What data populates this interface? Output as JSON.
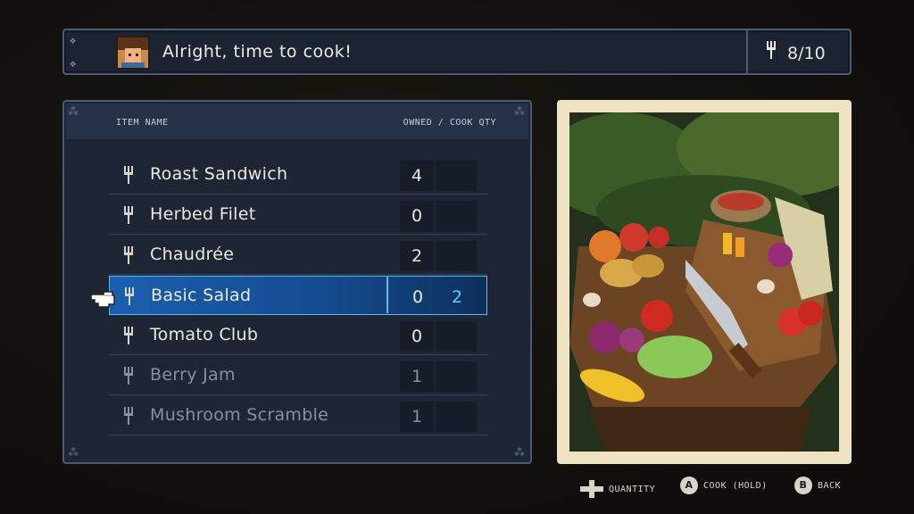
{
  "header": {
    "message": "Alright, time to cook!",
    "fork_count": "8/10"
  },
  "table": {
    "col_name": "ITEM NAME",
    "col_qty": "OWNED / COOK QTY",
    "rows": [
      {
        "name": "Roast Sandwich",
        "owned": "4",
        "qty": "",
        "dim": false
      },
      {
        "name": "Herbed Filet",
        "owned": "0",
        "qty": "",
        "dim": false
      },
      {
        "name": "Chaudrée",
        "owned": "2",
        "qty": "",
        "dim": false
      },
      {
        "name": "Basic Salad",
        "owned": "0",
        "qty": "2",
        "dim": false,
        "selected": true
      },
      {
        "name": "Tomato Club",
        "owned": "0",
        "qty": "",
        "dim": false
      },
      {
        "name": "Berry Jam",
        "owned": "1",
        "qty": "",
        "dim": true
      },
      {
        "name": "Mushroom Scramble",
        "owned": "1",
        "qty": "",
        "dim": true
      }
    ]
  },
  "hints": {
    "quantity": "QUANTITY",
    "cook_button": "A",
    "cook": "COOK (HOLD)",
    "back_button": "B",
    "back": "BACK"
  },
  "colors": {
    "selected_row": "#1a5fb0",
    "selected_border": "#5cb8f2",
    "cook_qty_text": "#6fc6ff",
    "card_frame": "#efe3c4"
  }
}
